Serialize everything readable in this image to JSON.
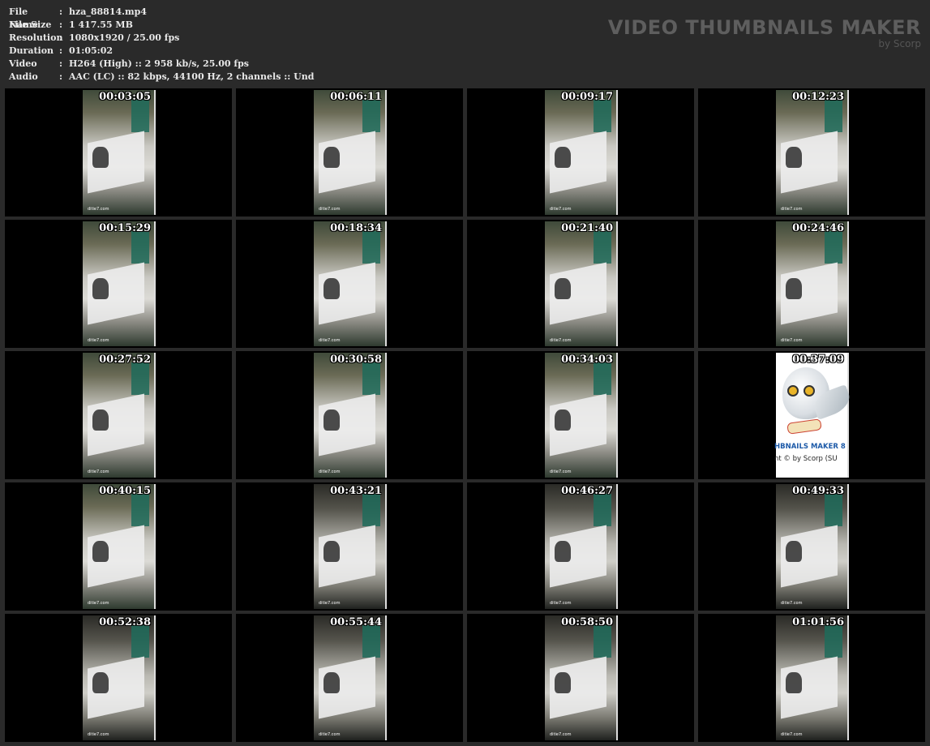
{
  "meta": [
    {
      "label": "File Name",
      "value": "hza_88814.mp4"
    },
    {
      "label": "File Size",
      "value": "1 417.55 MB"
    },
    {
      "label": "Resolution",
      "value": "1080x1920 / 25.00 fps"
    },
    {
      "label": "Duration",
      "value": "01:05:02"
    },
    {
      "label": "Video",
      "value": "H264 (High) :: 2 958 kb/s, 25.00 fps"
    },
    {
      "label": "Audio",
      "value": "AAC (LC) :: 82 kbps, 44100 Hz, 2 channels :: Und"
    }
  ],
  "brand": {
    "title": "VIDEO THUMBNAILS MAKER",
    "by": "by Scorp"
  },
  "thumbnails": [
    {
      "time": "00:03:05"
    },
    {
      "time": "00:06:11"
    },
    {
      "time": "00:09:17"
    },
    {
      "time": "00:12:23"
    },
    {
      "time": "00:15:29"
    },
    {
      "time": "00:18:34"
    },
    {
      "time": "00:21:40"
    },
    {
      "time": "00:24:46"
    },
    {
      "time": "00:27:52"
    },
    {
      "time": "00:30:58"
    },
    {
      "time": "00:34:03"
    },
    {
      "time": "00:37:09",
      "placeholder": true,
      "line1": "HBNAILS MAKER 8",
      "line2": "nt © by Scorp (SU"
    },
    {
      "time": "00:40:15"
    },
    {
      "time": "00:43:21"
    },
    {
      "time": "00:46:27"
    },
    {
      "time": "00:49:33"
    },
    {
      "time": "00:52:38"
    },
    {
      "time": "00:55:44"
    },
    {
      "time": "00:58:50"
    },
    {
      "time": "01:01:56"
    }
  ],
  "watermark": "ditie7.com"
}
